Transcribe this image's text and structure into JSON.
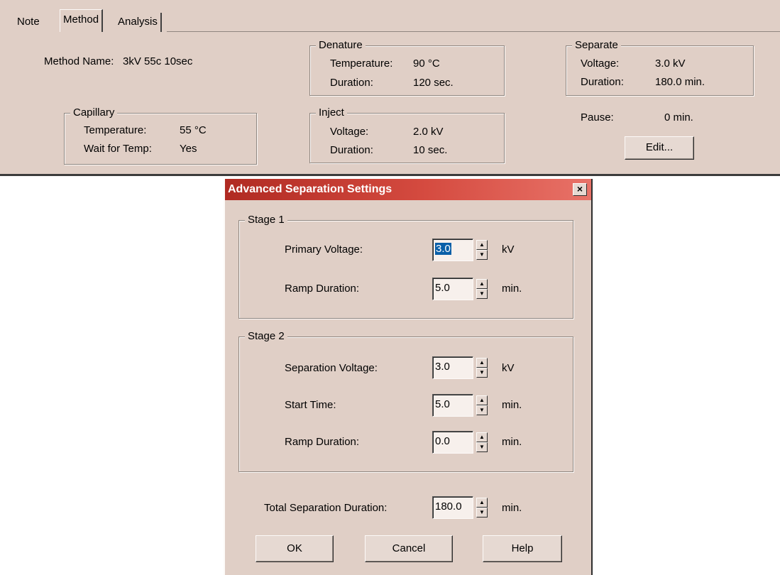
{
  "tabs": [
    {
      "label": "Note"
    },
    {
      "label": "Method"
    },
    {
      "label": "Analysis"
    }
  ],
  "method": {
    "name_label": "Method Name:",
    "name_value": "3kV 55c 10sec"
  },
  "capillary": {
    "title": "Capillary",
    "temp_label": "Temperature:",
    "temp_value": "55 °C",
    "wait_label": "Wait for Temp:",
    "wait_value": "Yes"
  },
  "denature": {
    "title": "Denature",
    "temp_label": "Temperature:",
    "temp_value": "90 °C",
    "duration_label": "Duration:",
    "duration_value": "120 sec."
  },
  "inject": {
    "title": "Inject",
    "voltage_label": "Voltage:",
    "voltage_value": "2.0 kV",
    "duration_label": "Duration:",
    "duration_value": "10 sec."
  },
  "separate": {
    "title": "Separate",
    "voltage_label": "Voltage:",
    "voltage_value": "3.0 kV",
    "duration_label": "Duration:",
    "duration_value": "180.0 min.",
    "pause_label": "Pause:",
    "pause_value": "0 min.",
    "edit_button": "Edit..."
  },
  "dialog": {
    "title": "Advanced Separation Settings",
    "close_glyph": "×",
    "stage1": {
      "title": "Stage 1",
      "primary_voltage_label": "Primary Voltage:",
      "primary_voltage_value": "3.0",
      "primary_voltage_unit": "kV",
      "ramp_label": "Ramp Duration:",
      "ramp_value": "5.0",
      "ramp_unit": "min."
    },
    "stage2": {
      "title": "Stage 2",
      "sep_voltage_label": "Separation Voltage:",
      "sep_voltage_value": "3.0",
      "sep_voltage_unit": "kV",
      "start_label": "Start Time:",
      "start_value": "5.0",
      "start_unit": "min.",
      "ramp_label": "Ramp Duration:",
      "ramp_value": "0.0",
      "ramp_unit": "min."
    },
    "total_label": "Total Separation Duration:",
    "total_value": "180.0",
    "total_unit": "min.",
    "buttons": {
      "ok": "OK",
      "cancel": "Cancel",
      "help": "Help"
    }
  },
  "colors": {
    "panel_bg": "#e0cfc6",
    "title_bar": "#c0392b",
    "selection": "#0a5fa8"
  }
}
